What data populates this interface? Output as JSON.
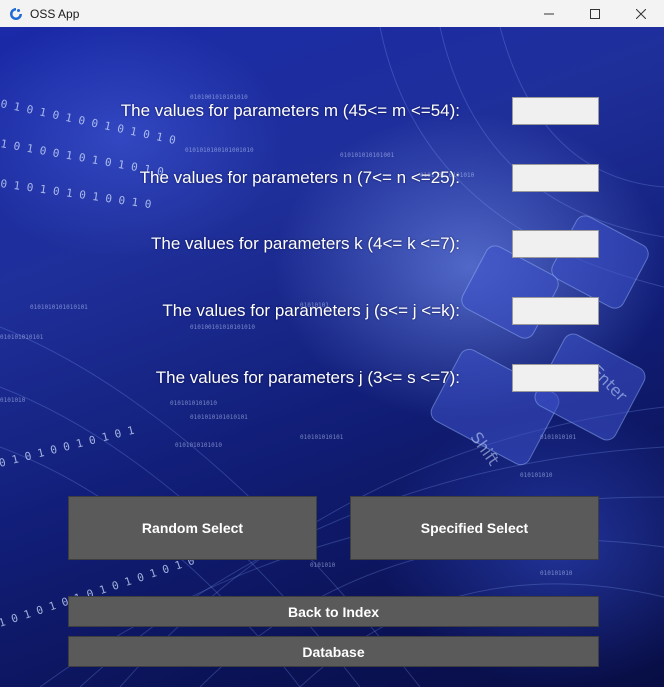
{
  "window": {
    "title": "OSS App",
    "icon": "swirl-app-icon",
    "controls": {
      "minimize": "—",
      "maximize": "☐",
      "close": "✕"
    }
  },
  "params": [
    {
      "label": "The values for parameters m (45<= m <=54):",
      "value": ""
    },
    {
      "label": "The values for parameters n (7<= n <=25):",
      "value": ""
    },
    {
      "label": "The values for parameters k (4<= k <=7):",
      "value": ""
    },
    {
      "label": "The values for parameters j (s<= j <=k):",
      "value": ""
    },
    {
      "label": "The values for parameters j (3<= s <=7):",
      "value": ""
    }
  ],
  "buttons": {
    "random_select": "Random Select",
    "specified_select": "Specified Select",
    "back_to_index": "Back to Index",
    "database": "Database"
  },
  "colors": {
    "button_bg": "#5a5a5a",
    "input_bg": "#f0f0f0",
    "titlebar_bg": "#f3f3f3"
  }
}
